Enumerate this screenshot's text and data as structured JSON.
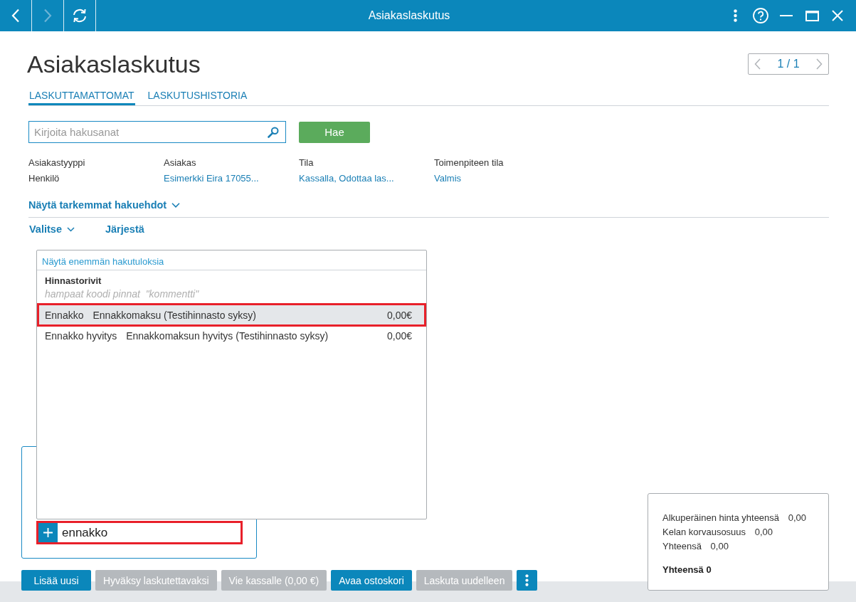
{
  "window": {
    "title": "Asiakaslaskutus",
    "back_button": {
      "disabled": false
    },
    "forward_button": {
      "disabled": true
    }
  },
  "page": {
    "title": "Asiakaslaskutus",
    "pager": {
      "text": "1 / 1",
      "previous_disabled": true,
      "next_disabled": true
    }
  },
  "tabs": [
    {
      "label": "LASKUTTAMATTOMAT",
      "selected": true
    },
    {
      "label": "LASKUTUSHISTORIA",
      "selected": false
    }
  ],
  "search": {
    "placeholder": "Kirjoita hakusanat",
    "button": "Hae"
  },
  "filters": [
    {
      "label": "Asiakastyyppi",
      "value": "Henkilö",
      "kind": "text"
    },
    {
      "label": "Asiakas",
      "value": "Esimerkki Eira 17055...",
      "kind": "link"
    },
    {
      "label": "Tila",
      "value": "Kassalla, Odottaa las...",
      "kind": "link"
    },
    {
      "label": "Toimenpiteen tila",
      "value": "Valmis",
      "kind": "link"
    }
  ],
  "advanced_search": {
    "label": "Näytä tarkemmat hakuehdot",
    "expanded": false
  },
  "actions": [
    {
      "label": "Valitse",
      "has_menu": true
    },
    {
      "label": "Järjestä",
      "has_menu": false
    }
  ],
  "suggestions": {
    "more_link": "Näytä enemmän hakutuloksia",
    "group_title": "Hinnastorivit",
    "hint": "hampaat koodi pinnat  \"kommentti\"",
    "results": [
      {
        "code": "Ennakko",
        "name": "Ennakkomaksu (Testihinnasto syksy)",
        "price": "0,00€",
        "selected": true,
        "highlighted": true
      },
      {
        "code": "Ennakko hyvitys",
        "name": "Ennakkomaksun hyvitys (Testihinnasto syksy)",
        "price": "0,00€",
        "selected": false,
        "highlighted": false
      }
    ]
  },
  "entry": {
    "value": "ennakko",
    "highlighted": true
  },
  "buttons": [
    {
      "label": "Lisää uusi",
      "disabled": false
    },
    {
      "label": "Hyväksy laskutettavaksi",
      "disabled": true
    },
    {
      "label": "Vie kassalle (0,00 €)",
      "disabled": true
    },
    {
      "label": "Avaa ostoskori",
      "disabled": false
    },
    {
      "label": "Laskuta uudelleen",
      "disabled": true
    }
  ],
  "totals": {
    "lines": [
      {
        "label": "Alkuperäinen hinta yhteensä",
        "value": "0,00"
      },
      {
        "label": "Kelan korvausosuus",
        "value": "0,00"
      },
      {
        "label": "Yhteensä",
        "value": "0,00"
      }
    ],
    "total": "Yhteensä 0"
  }
}
